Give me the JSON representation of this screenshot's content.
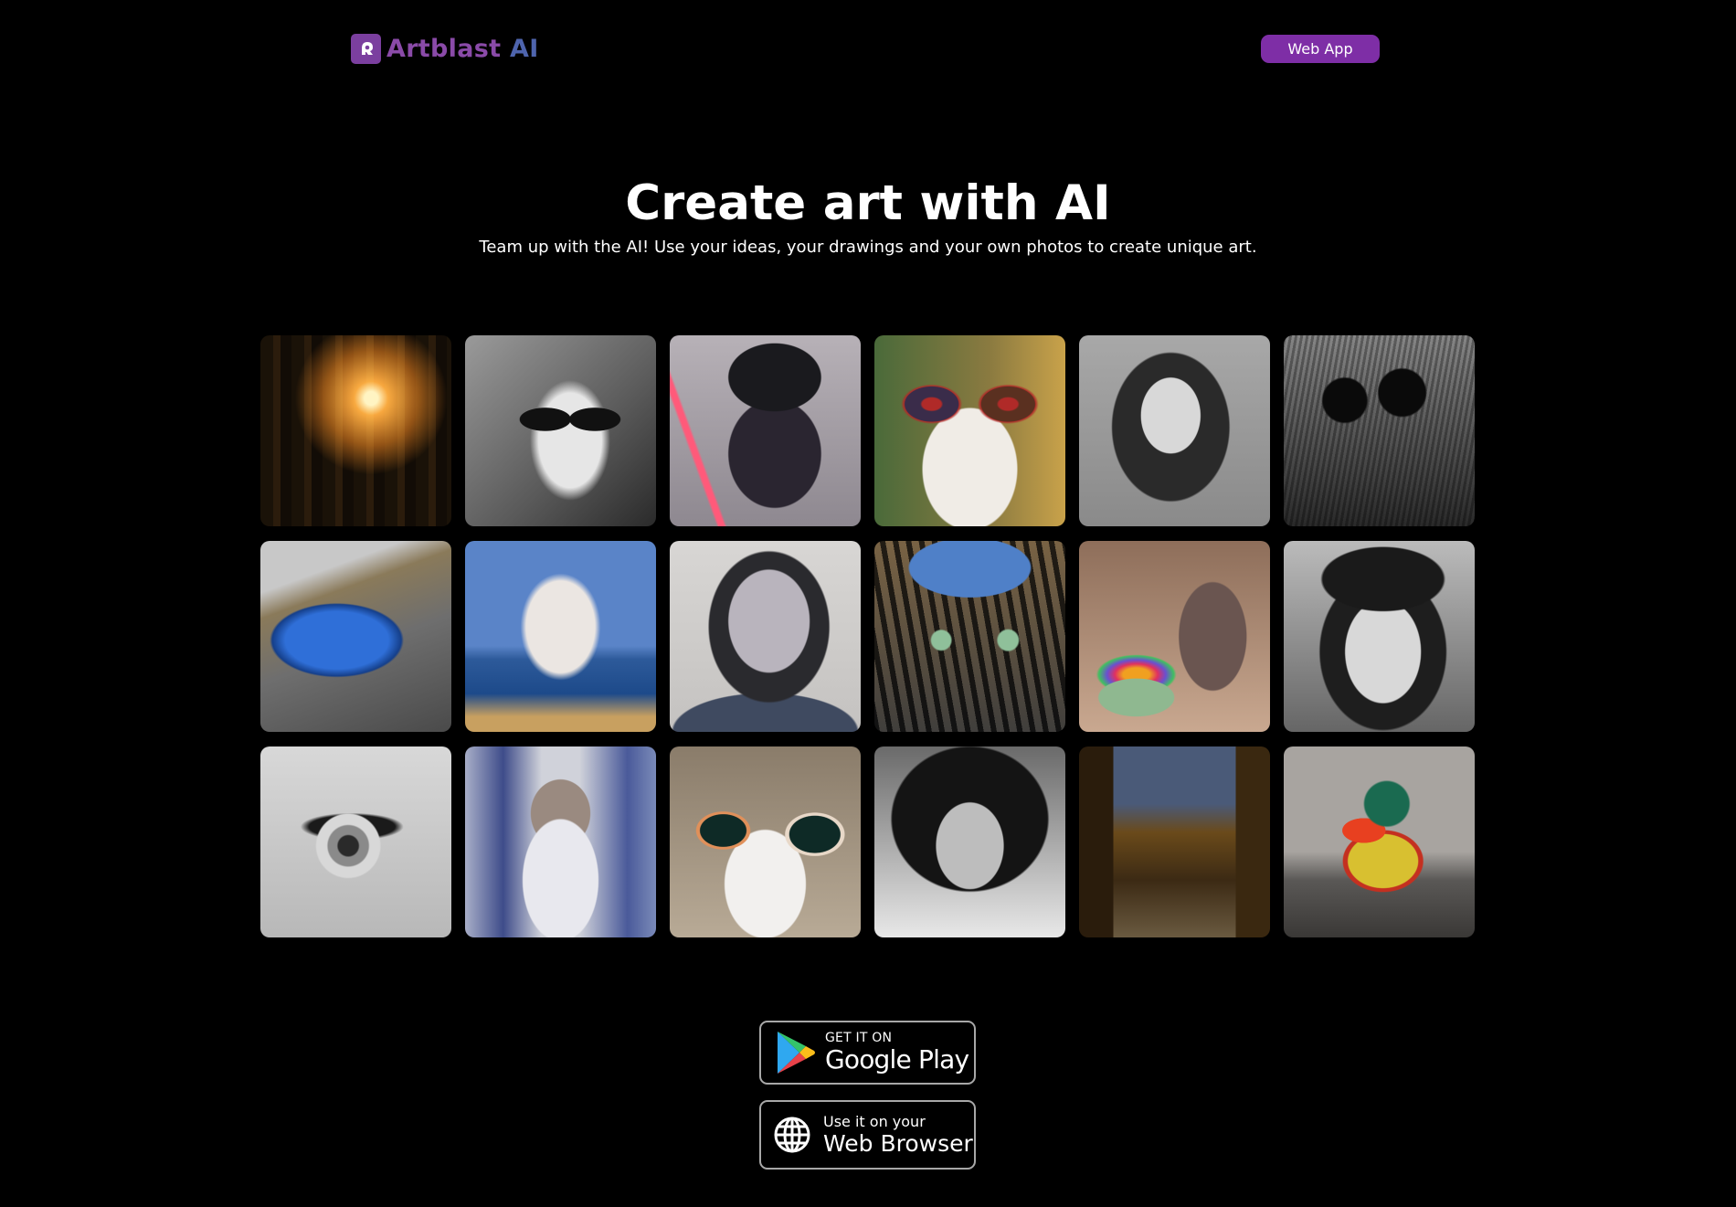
{
  "header": {
    "logo_text": "Artblast",
    "logo_suffix": "AI",
    "logo_icon": "artblast-logo-icon",
    "web_app_button": "Web App"
  },
  "hero": {
    "title": "Create art with AI",
    "subtitle": "Team up with the AI! Use your ideas, your drawings and your own photos to create unique art."
  },
  "gallery": {
    "items": [
      {
        "subject": "sunlit forest"
      },
      {
        "subject": "goat with sunglasses"
      },
      {
        "subject": "darth vader figurine"
      },
      {
        "subject": "dog with red sunglasses"
      },
      {
        "subject": "woman portrait"
      },
      {
        "subject": "cat with round sunglasses"
      },
      {
        "subject": "blue sports car"
      },
      {
        "subject": "sailing ship painting"
      },
      {
        "subject": "watercolor girl portrait"
      },
      {
        "subject": "cat with blue hat"
      },
      {
        "subject": "wooden elephant with candy bowl"
      },
      {
        "subject": "smiling woman in hat"
      },
      {
        "subject": "eye close-up"
      },
      {
        "subject": "old wizard portrait"
      },
      {
        "subject": "dog with goggles"
      },
      {
        "subject": "smiling woman with afro"
      },
      {
        "subject": "old town street at night"
      },
      {
        "subject": "toy duck"
      }
    ]
  },
  "downloads": {
    "google_play": {
      "small": "GET IT ON",
      "big": "Google Play",
      "icon": "google-play-icon"
    },
    "web_browser": {
      "small": "Use it on your",
      "big": "Web Browser",
      "icon": "globe-icon"
    }
  },
  "colors": {
    "background": "#000000",
    "accent_purple": "#7e2ea6",
    "logo_purple": "#8a4aa8",
    "logo_blue": "#4e64ad",
    "text": "#ffffff"
  }
}
